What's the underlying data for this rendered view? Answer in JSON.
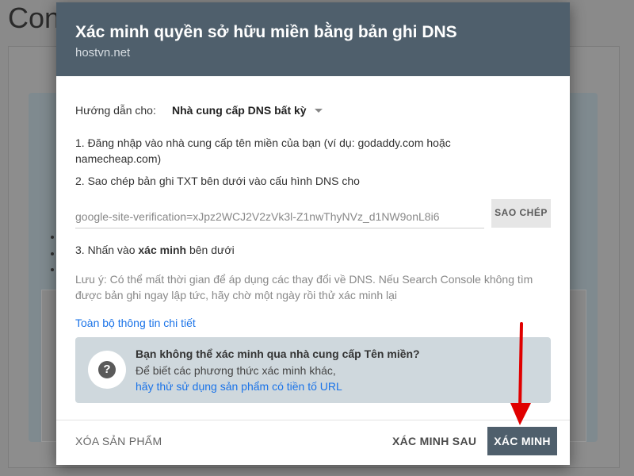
{
  "background": {
    "title_fragment": "Con"
  },
  "dialog": {
    "title": "Xác minh quyền sở hữu miền bằng bản ghi DNS",
    "subtitle": "hostvn.net",
    "guide_label": "Hướng dẫn cho:",
    "guide_value": "Nhà cung cấp DNS bất kỳ",
    "step1": "1. Đăng nhập vào nhà cung cấp tên miền của bạn (ví dụ: godaddy.com hoặc namecheap.com)",
    "step2": "2. Sao chép bản ghi TXT bên dưới vào cấu hình DNS cho",
    "txt_record": "google-site-verification=xJpz2WCJ2V2zVk3l-Z1nwThyNVz_d1NW9onL8i6",
    "copy_label": "SAO CHÉP",
    "step3_prefix": "3. Nhấn vào ",
    "step3_bold": "xác minh",
    "step3_suffix": " bên dưới",
    "note": "Lưu ý: Có thể mất thời gian để áp dụng các thay đổi về DNS. Nếu Search Console không tìm được bản ghi ngay lập tức, hãy chờ một ngày rồi thử xác minh lại",
    "details_link": "Toàn bộ thông tin chi tiết",
    "help": {
      "icon": "question-icon",
      "title": "Bạn không thể xác minh qua nhà cung cấp Tên miền?",
      "desc": "Để biết các phương thức xác minh khác,",
      "link": "hãy thử sử dụng sản phẩm có tiền tố URL"
    },
    "footer": {
      "remove": "XÓA SẢN PHẨM",
      "later": "XÁC MINH SAU",
      "verify": "XÁC MINH"
    }
  },
  "colors": {
    "header": "#4f5f6c",
    "link": "#1a73e8",
    "arrow": "#e00000"
  }
}
